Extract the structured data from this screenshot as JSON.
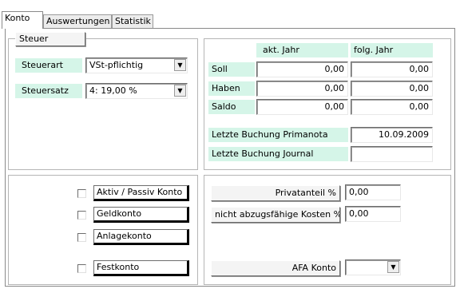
{
  "tabs": [
    {
      "label": "Konto",
      "active": true
    },
    {
      "label": "Auswertungen",
      "active": false
    },
    {
      "label": "Statistik",
      "active": false
    }
  ],
  "steuer": {
    "title": "Steuer",
    "steuerart_label": "Steuerart",
    "steuerart_value": "VSt-pflichtig",
    "steuersatz_label": "Steuersatz",
    "steuersatz_value": "4: 19,00 %"
  },
  "balances": {
    "col_current": "akt. Jahr",
    "col_next": "folg. Jahr",
    "rows": [
      {
        "label": "Soll",
        "current": "0,00",
        "next": "0,00"
      },
      {
        "label": "Haben",
        "current": "0,00",
        "next": "0,00"
      },
      {
        "label": "Saldo",
        "current": "0,00",
        "next": "0,00"
      }
    ],
    "last_primanota_label": "Letzte Buchung Primanota",
    "last_primanota_value": "10.09.2009",
    "last_journal_label": "Letzte Buchung Journal",
    "last_journal_value": ""
  },
  "flags": [
    {
      "label": "Aktiv / Passiv Konto",
      "checked": false
    },
    {
      "label": "Geldkonto",
      "checked": false
    },
    {
      "label": "Anlagekonto",
      "checked": false
    },
    {
      "label": "Festkonto",
      "checked": false
    }
  ],
  "costs": {
    "privatanteil_label": "Privatanteil %",
    "privatanteil_value": "0,00",
    "nicht_abzug_label": "nicht abzugsfähige Kosten %",
    "nicht_abzug_value": "0,00",
    "afa_label": "AFA Konto",
    "afa_value": ""
  },
  "colors": {
    "label_bg": "#d5f5e8"
  }
}
